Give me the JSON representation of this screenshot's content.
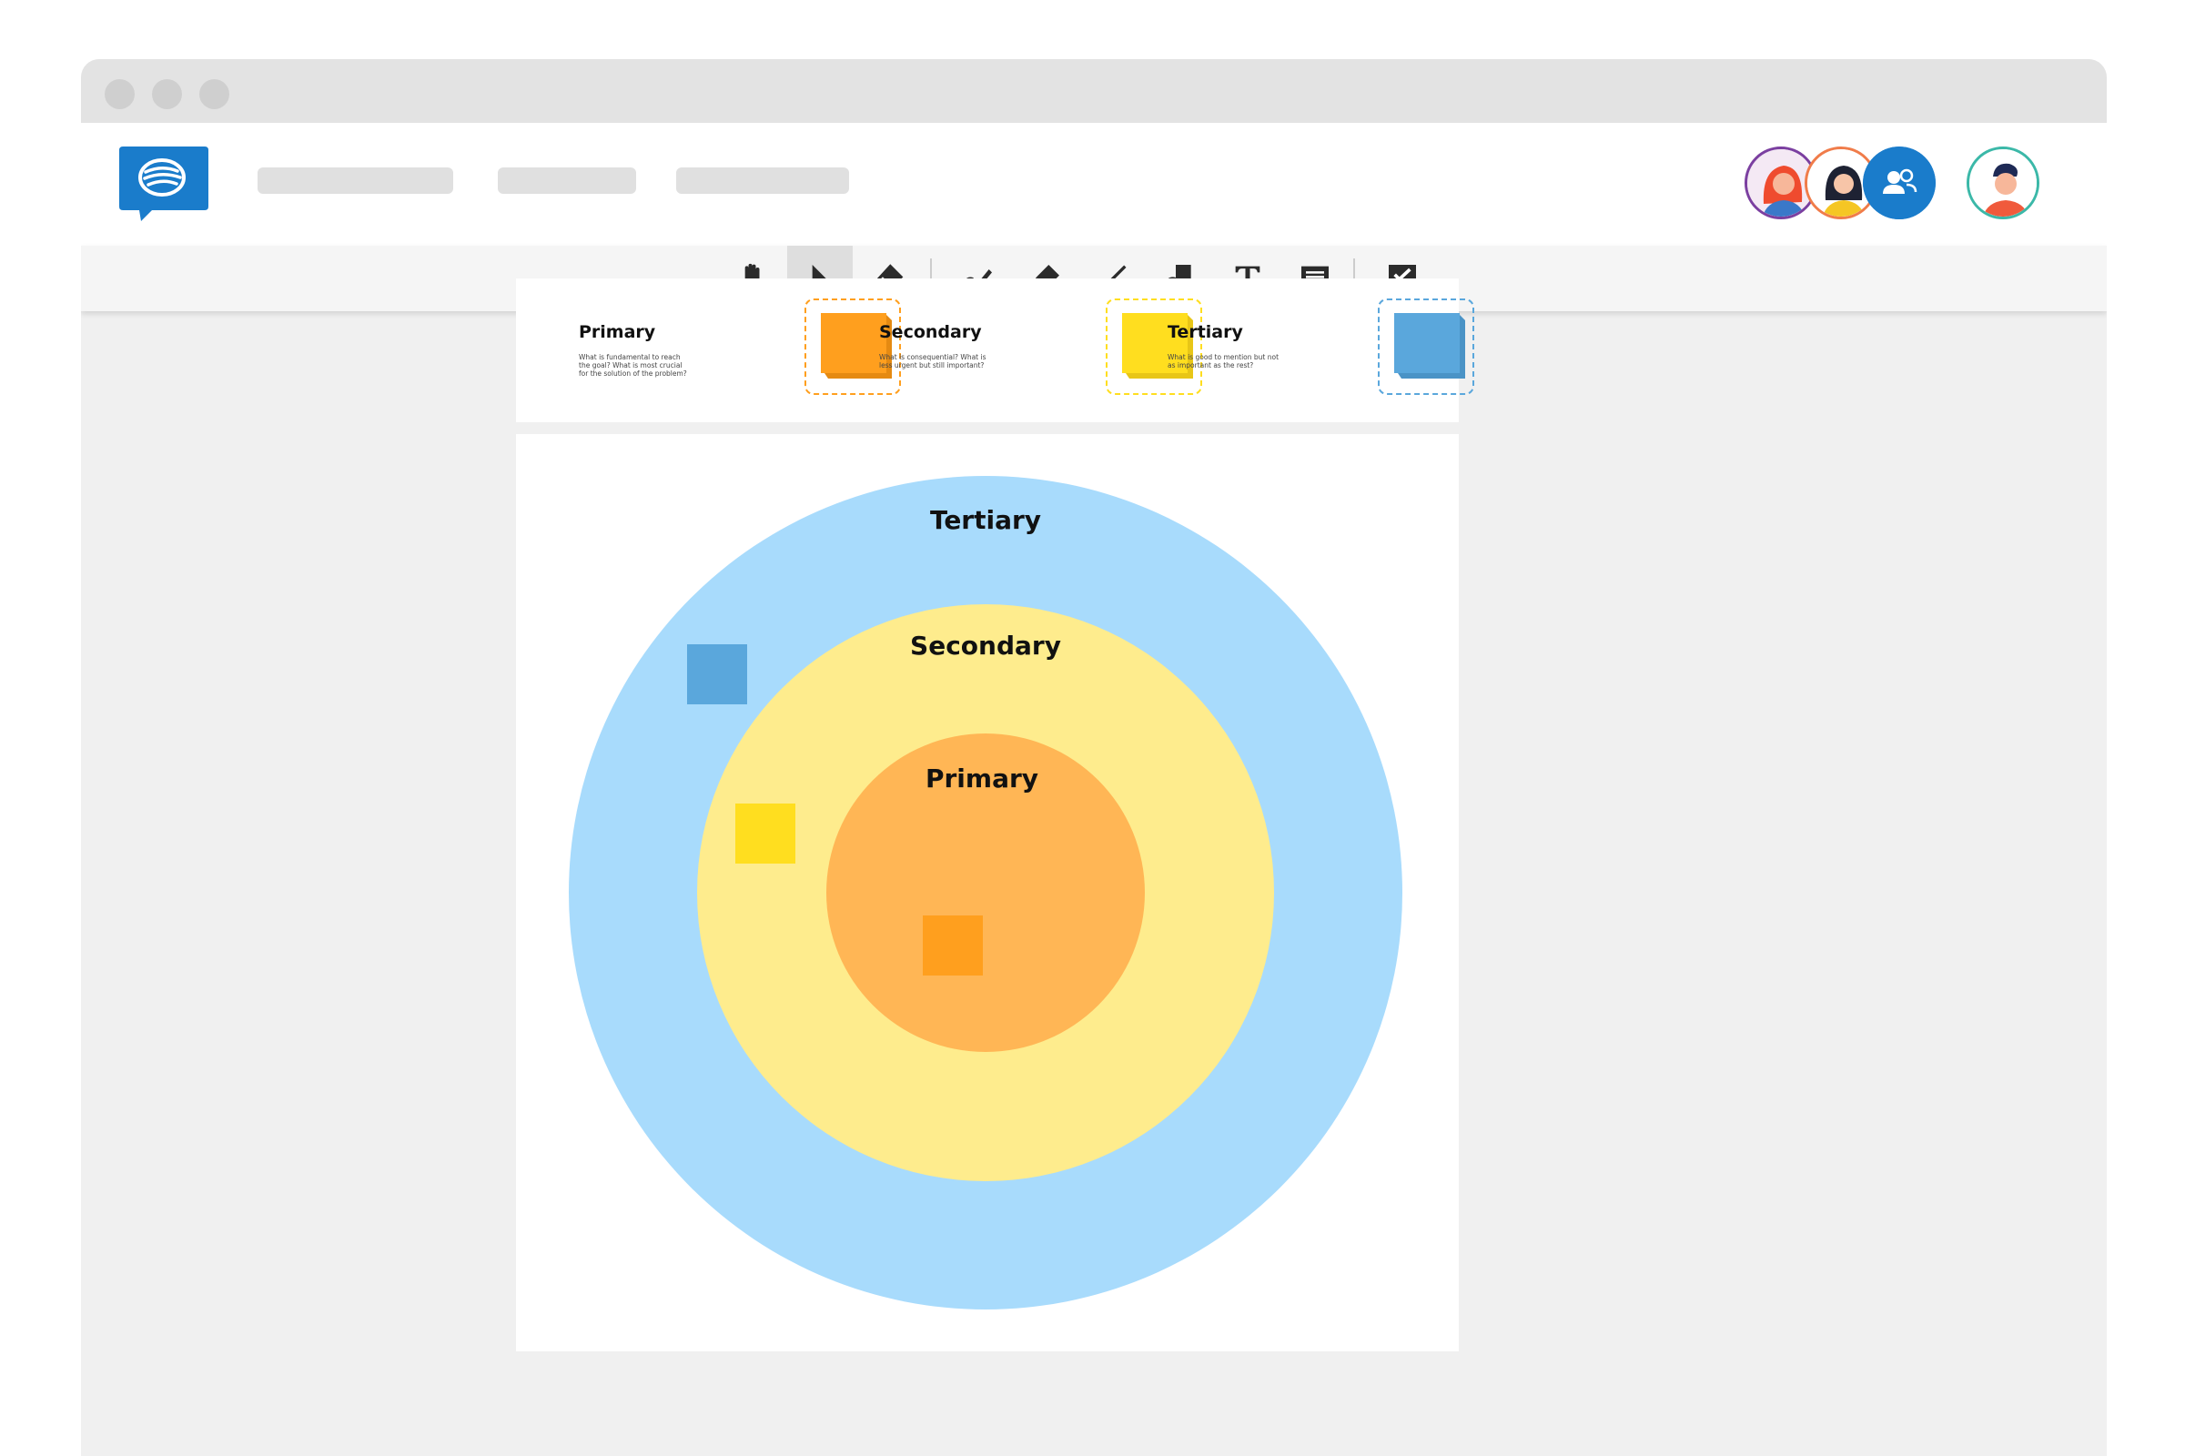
{
  "colors": {
    "brand": "#1a7ccb",
    "primary": "#ff9f1e",
    "primary_ring": "#ffb655",
    "secondary": "#ffde1f",
    "secondary_ring": "#feec8d",
    "tertiary": "#5aa7dc",
    "tertiary_ring": "#a8dbfc"
  },
  "toolbar": {
    "tools": [
      "hand-tool",
      "select-tool",
      "eraser-tool",
      "pen-tool",
      "highlighter-tool",
      "line-tool",
      "shapes-tool",
      "text-tool",
      "sticky-note-tool",
      "comment-tool"
    ],
    "active_tool": "select-tool"
  },
  "legend": {
    "items": [
      {
        "title": "Primary",
        "description": "What is fundamental to reach the goal? What is most crucial for the solution of the problem?"
      },
      {
        "title": "Secondary",
        "description": "What is consequential? What is less urgent but still important?"
      },
      {
        "title": "Tertiary",
        "description": "What is good to mention but not as important as the rest?"
      }
    ]
  },
  "diagram": {
    "outer_label": "Tertiary",
    "middle_label": "Secondary",
    "inner_label": "Primary"
  }
}
